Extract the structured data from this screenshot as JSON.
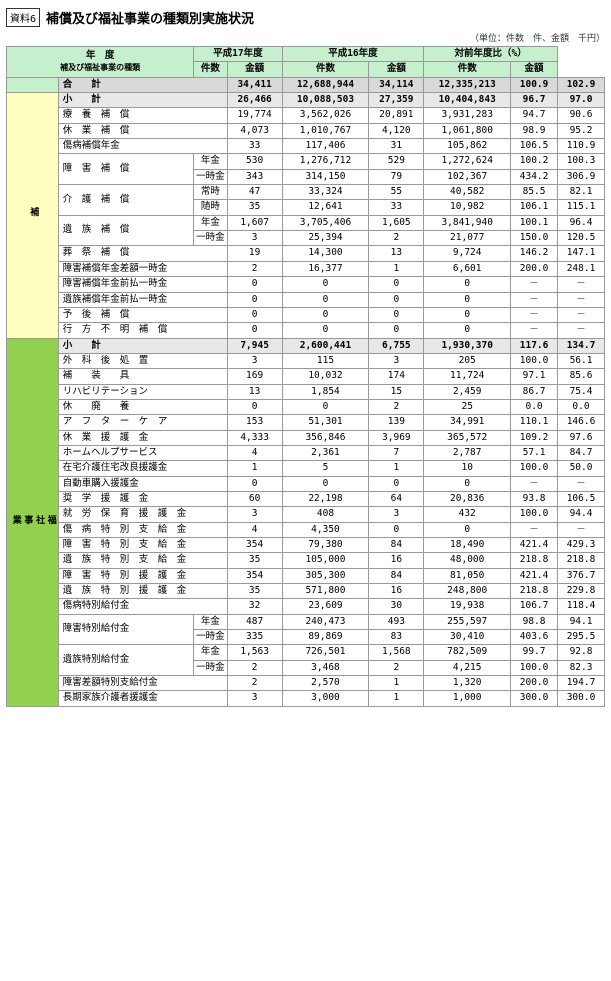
{
  "title": "補償及び福祉事業の種類別実施状況",
  "tag": "資料6",
  "unit_note": "（単位：件数　件、金額　千円）",
  "headers": {
    "year_col": "年　度",
    "category_col": "補及び福祉事業の種類",
    "h17": "平成17年度",
    "h16": "平成16年度",
    "ratio": "対前年度比（%）",
    "kensu": "件数",
    "kingaku": "金額"
  },
  "rows": [
    {
      "type": "total",
      "label": "合　　計",
      "h17_ken": "34,411",
      "h17_kin": "12,688,944",
      "h16_ken": "34,114",
      "h16_kin": "12,335,213",
      "r_ken": "100.9",
      "r_kin": "102.9",
      "indent": 0,
      "group": ""
    },
    {
      "type": "subtotal",
      "label": "小　　計",
      "h17_ken": "26,466",
      "h17_kin": "10,088,503",
      "h16_ken": "27,359",
      "h16_kin": "10,404,843",
      "r_ken": "96.7",
      "r_kin": "97.0",
      "indent": 0,
      "group": "hoso"
    },
    {
      "type": "data",
      "label": "療　養　補　償",
      "h17_ken": "19,774",
      "h17_kin": "3,562,026",
      "h16_ken": "20,891",
      "h16_kin": "3,931,283",
      "r_ken": "94.7",
      "r_kin": "90.6",
      "indent": 1,
      "group": "hoso"
    },
    {
      "type": "data",
      "label": "休　業　補　償",
      "h17_ken": "4,073",
      "h17_kin": "1,010,767",
      "h16_ken": "4,120",
      "h16_kin": "1,061,800",
      "r_ken": "98.9",
      "r_kin": "95.2",
      "indent": 1,
      "group": "hoso"
    },
    {
      "type": "data",
      "label": "傷病補償年金",
      "h17_ken": "33",
      "h17_kin": "117,406",
      "h16_ken": "31",
      "h16_kin": "105,862",
      "r_ken": "106.5",
      "r_kin": "110.9",
      "indent": 1,
      "group": "hoso"
    },
    {
      "type": "data2",
      "label": "障　害　補　償",
      "sub": "年金",
      "h17_ken": "530",
      "h17_kin": "1,276,712",
      "h16_ken": "529",
      "h16_kin": "1,272,624",
      "r_ken": "100.2",
      "r_kin": "100.3",
      "indent": 1,
      "group": "hoso"
    },
    {
      "type": "data2sub",
      "label": "",
      "sub": "一時金",
      "h17_ken": "343",
      "h17_kin": "314,150",
      "h16_ken": "79",
      "h16_kin": "102,367",
      "r_ken": "434.2",
      "r_kin": "306.9",
      "indent": 1,
      "group": "hoso"
    },
    {
      "type": "data2",
      "label": "介　護　補　償",
      "sub": "常時",
      "h17_ken": "47",
      "h17_kin": "33,324",
      "h16_ken": "55",
      "h16_kin": "40,582",
      "r_ken": "85.5",
      "r_kin": "82.1",
      "indent": 1,
      "group": "hoso"
    },
    {
      "type": "data2sub",
      "label": "",
      "sub": "随時",
      "h17_ken": "35",
      "h17_kin": "12,641",
      "h16_ken": "33",
      "h16_kin": "10,982",
      "r_ken": "106.1",
      "r_kin": "115.1",
      "indent": 1,
      "group": "hoso"
    },
    {
      "type": "data2",
      "label": "遺　族　補　償",
      "sub": "年金",
      "h17_ken": "1,607",
      "h17_kin": "3,705,406",
      "h16_ken": "1,605",
      "h16_kin": "3,841,940",
      "r_ken": "100.1",
      "r_kin": "96.4",
      "indent": 1,
      "group": "hoso"
    },
    {
      "type": "data2sub",
      "label": "",
      "sub": "一時金",
      "h17_ken": "3",
      "h17_kin": "25,394",
      "h16_ken": "2",
      "h16_kin": "21,077",
      "r_ken": "150.0",
      "r_kin": "120.5",
      "indent": 1,
      "group": "hoso"
    },
    {
      "type": "data",
      "label": "葬　祭　補　償",
      "h17_ken": "19",
      "h17_kin": "14,300",
      "h16_ken": "13",
      "h16_kin": "9,724",
      "r_ken": "146.2",
      "r_kin": "147.1",
      "indent": 1,
      "group": "hoso"
    },
    {
      "type": "data",
      "label": "障害補償年金差額一時金",
      "h17_ken": "2",
      "h17_kin": "16,377",
      "h16_ken": "1",
      "h16_kin": "6,601",
      "r_ken": "200.0",
      "r_kin": "248.1",
      "indent": 1,
      "group": "hoso"
    },
    {
      "type": "data",
      "label": "障害補償年金前払一時金",
      "h17_ken": "0",
      "h17_kin": "0",
      "h16_ken": "0",
      "h16_kin": "0",
      "r_ken": "－",
      "r_kin": "－",
      "indent": 1,
      "group": "hoso"
    },
    {
      "type": "data",
      "label": "遺族補償年金前払一時金",
      "h17_ken": "0",
      "h17_kin": "0",
      "h16_ken": "0",
      "h16_kin": "0",
      "r_ken": "－",
      "r_kin": "－",
      "indent": 1,
      "group": "hoso"
    },
    {
      "type": "data",
      "label": "予　後　補　償",
      "h17_ken": "0",
      "h17_kin": "0",
      "h16_ken": "0",
      "h16_kin": "0",
      "r_ken": "－",
      "r_kin": "－",
      "indent": 1,
      "group": "hoso"
    },
    {
      "type": "data",
      "label": "行　方　不　明　補　償",
      "h17_ken": "0",
      "h17_kin": "0",
      "h16_ken": "0",
      "h16_kin": "0",
      "r_ken": "－",
      "r_kin": "－",
      "indent": 1,
      "group": "hoso"
    },
    {
      "type": "subtotal",
      "label": "小　　計",
      "h17_ken": "7,945",
      "h17_kin": "2,600,441",
      "h16_ken": "6,755",
      "h16_kin": "1,930,370",
      "r_ken": "117.6",
      "r_kin": "134.7",
      "indent": 0,
      "group": "welfare"
    },
    {
      "type": "data",
      "label": "外　科　後　処　置",
      "h17_ken": "3",
      "h17_kin": "115",
      "h16_ken": "3",
      "h16_kin": "205",
      "r_ken": "100.0",
      "r_kin": "56.1",
      "indent": 1,
      "group": "welfare"
    },
    {
      "type": "data",
      "label": "補　　装　　具",
      "h17_ken": "169",
      "h17_kin": "10,032",
      "h16_ken": "174",
      "h16_kin": "11,724",
      "r_ken": "97.1",
      "r_kin": "85.6",
      "indent": 1,
      "group": "welfare"
    },
    {
      "type": "data",
      "label": "リハビリテーション",
      "h17_ken": "13",
      "h17_kin": "1,854",
      "h16_ken": "15",
      "h16_kin": "2,459",
      "r_ken": "86.7",
      "r_kin": "75.4",
      "indent": 1,
      "group": "welfare"
    },
    {
      "type": "data",
      "label": "休　　廃　　養",
      "h17_ken": "0",
      "h17_kin": "0",
      "h16_ken": "2",
      "h16_kin": "25",
      "r_ken": "0.0",
      "r_kin": "0.0",
      "indent": 1,
      "group": "welfare"
    },
    {
      "type": "data",
      "label": "ア　フ　タ　ー　ケ　ア",
      "h17_ken": "153",
      "h17_kin": "51,301",
      "h16_ken": "139",
      "h16_kin": "34,991",
      "r_ken": "110.1",
      "r_kin": "146.6",
      "indent": 1,
      "group": "welfare"
    },
    {
      "type": "data",
      "label": "休　業　援　護　金",
      "h17_ken": "4,333",
      "h17_kin": "356,846",
      "h16_ken": "3,969",
      "h16_kin": "365,572",
      "r_ken": "109.2",
      "r_kin": "97.6",
      "indent": 1,
      "group": "welfare"
    },
    {
      "type": "data",
      "label": "ホームヘルプサービス",
      "h17_ken": "4",
      "h17_kin": "2,361",
      "h16_ken": "7",
      "h16_kin": "2,787",
      "r_ken": "57.1",
      "r_kin": "84.7",
      "indent": 1,
      "group": "welfare"
    },
    {
      "type": "data",
      "label": "在宅介護住宅改良援護金",
      "h17_ken": "1",
      "h17_kin": "5",
      "h16_ken": "1",
      "h16_kin": "10",
      "r_ken": "100.0",
      "r_kin": "50.0",
      "indent": 1,
      "group": "welfare"
    },
    {
      "type": "data",
      "label": "自動車購入援護金",
      "h17_ken": "0",
      "h17_kin": "0",
      "h16_ken": "0",
      "h16_kin": "0",
      "r_ken": "－",
      "r_kin": "－",
      "indent": 1,
      "group": "welfare"
    },
    {
      "type": "data",
      "label": "奨　学　援　護　金",
      "h17_ken": "60",
      "h17_kin": "22,198",
      "h16_ken": "64",
      "h16_kin": "20,836",
      "r_ken": "93.8",
      "r_kin": "106.5",
      "indent": 1,
      "group": "welfare"
    },
    {
      "type": "data",
      "label": "就　労　保　育　援　護　金",
      "h17_ken": "3",
      "h17_kin": "408",
      "h16_ken": "3",
      "h16_kin": "432",
      "r_ken": "100.0",
      "r_kin": "94.4",
      "indent": 1,
      "group": "welfare"
    },
    {
      "type": "data",
      "label": "傷　病　特　別　支　給　金",
      "h17_ken": "4",
      "h17_kin": "4,350",
      "h16_ken": "0",
      "h16_kin": "0",
      "r_ken": "－",
      "r_kin": "－",
      "indent": 1,
      "group": "welfare"
    },
    {
      "type": "data",
      "label": "障　害　特　別　支　給　金",
      "h17_ken": "354",
      "h17_kin": "79,380",
      "h16_ken": "84",
      "h16_kin": "18,490",
      "r_ken": "421.4",
      "r_kin": "429.3",
      "indent": 1,
      "group": "welfare"
    },
    {
      "type": "data",
      "label": "遺　族　特　別　支　給　金",
      "h17_ken": "35",
      "h17_kin": "105,000",
      "h16_ken": "16",
      "h16_kin": "48,000",
      "r_ken": "218.8",
      "r_kin": "218.8",
      "indent": 1,
      "group": "welfare"
    },
    {
      "type": "data",
      "label": "障　害　特　別　援　護　金",
      "h17_ken": "354",
      "h17_kin": "305,300",
      "h16_ken": "84",
      "h16_kin": "81,050",
      "r_ken": "421.4",
      "r_kin": "376.7",
      "indent": 1,
      "group": "welfare"
    },
    {
      "type": "data",
      "label": "遺　族　特　別　援　護　金",
      "h17_ken": "35",
      "h17_kin": "571,800",
      "h16_ken": "16",
      "h16_kin": "248,800",
      "r_ken": "218.8",
      "r_kin": "229.8",
      "indent": 1,
      "group": "welfare"
    },
    {
      "type": "data",
      "label": "傷病特別給付金",
      "h17_ken": "32",
      "h17_kin": "23,609",
      "h16_ken": "30",
      "h16_kin": "19,938",
      "r_ken": "106.7",
      "r_kin": "118.4",
      "indent": 1,
      "group": "welfare"
    },
    {
      "type": "data2",
      "label": "障害特別給付金",
      "sub": "年金",
      "h17_ken": "487",
      "h17_kin": "240,473",
      "h16_ken": "493",
      "h16_kin": "255,597",
      "r_ken": "98.8",
      "r_kin": "94.1",
      "indent": 1,
      "group": "welfare"
    },
    {
      "type": "data2sub",
      "label": "",
      "sub": "一時金",
      "h17_ken": "335",
      "h17_kin": "89,869",
      "h16_ken": "83",
      "h16_kin": "30,410",
      "r_ken": "403.6",
      "r_kin": "295.5",
      "indent": 1,
      "group": "welfare"
    },
    {
      "type": "data2",
      "label": "遺族特別給付金",
      "sub": "年金",
      "h17_ken": "1,563",
      "h17_kin": "726,501",
      "h16_ken": "1,568",
      "h16_kin": "782,509",
      "r_ken": "99.7",
      "r_kin": "92.8",
      "indent": 1,
      "group": "welfare"
    },
    {
      "type": "data2sub",
      "label": "",
      "sub": "一時金",
      "h17_ken": "2",
      "h17_kin": "3,468",
      "h16_ken": "2",
      "h16_kin": "4,215",
      "r_ken": "100.0",
      "r_kin": "82.3",
      "indent": 1,
      "group": "welfare"
    },
    {
      "type": "data",
      "label": "障害差額特別支給付金",
      "h17_ken": "2",
      "h17_kin": "2,570",
      "h16_ken": "1",
      "h16_kin": "1,320",
      "r_ken": "200.0",
      "r_kin": "194.7",
      "indent": 1,
      "group": "welfare"
    },
    {
      "type": "data",
      "label": "長期家族介護者援護金",
      "h17_ken": "3",
      "h17_kin": "3,000",
      "h16_ken": "1",
      "h16_kin": "1,000",
      "r_ken": "300.0",
      "r_kin": "300.0",
      "indent": 1,
      "group": "welfare"
    }
  ]
}
